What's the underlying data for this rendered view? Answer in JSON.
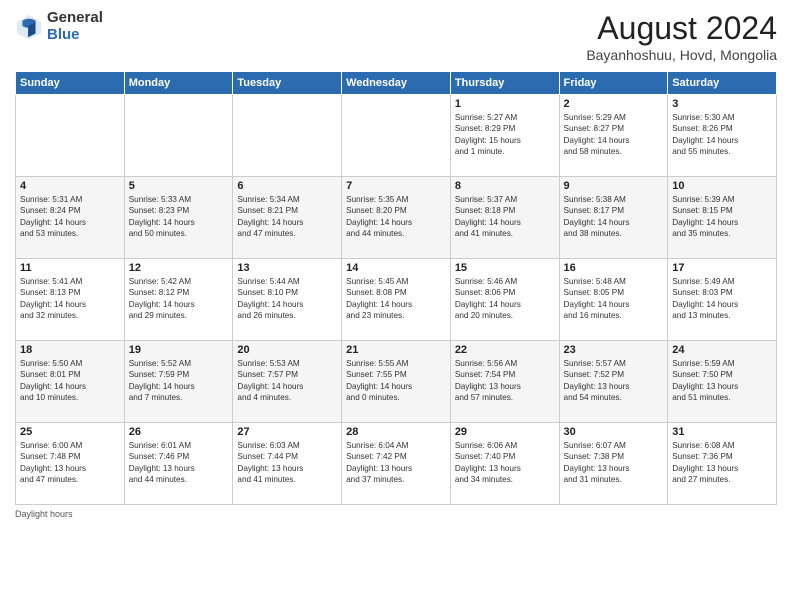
{
  "header": {
    "logo_general": "General",
    "logo_blue": "Blue",
    "month_title": "August 2024",
    "location": "Bayanhoshuu, Hovd, Mongolia"
  },
  "days_of_week": [
    "Sunday",
    "Monday",
    "Tuesday",
    "Wednesday",
    "Thursday",
    "Friday",
    "Saturday"
  ],
  "footer_text": "Daylight hours",
  "weeks": [
    [
      {
        "day": "",
        "info": ""
      },
      {
        "day": "",
        "info": ""
      },
      {
        "day": "",
        "info": ""
      },
      {
        "day": "",
        "info": ""
      },
      {
        "day": "1",
        "info": "Sunrise: 5:27 AM\nSunset: 8:29 PM\nDaylight: 15 hours\nand 1 minute."
      },
      {
        "day": "2",
        "info": "Sunrise: 5:29 AM\nSunset: 8:27 PM\nDaylight: 14 hours\nand 58 minutes."
      },
      {
        "day": "3",
        "info": "Sunrise: 5:30 AM\nSunset: 8:26 PM\nDaylight: 14 hours\nand 55 minutes."
      }
    ],
    [
      {
        "day": "4",
        "info": "Sunrise: 5:31 AM\nSunset: 8:24 PM\nDaylight: 14 hours\nand 53 minutes."
      },
      {
        "day": "5",
        "info": "Sunrise: 5:33 AM\nSunset: 8:23 PM\nDaylight: 14 hours\nand 50 minutes."
      },
      {
        "day": "6",
        "info": "Sunrise: 5:34 AM\nSunset: 8:21 PM\nDaylight: 14 hours\nand 47 minutes."
      },
      {
        "day": "7",
        "info": "Sunrise: 5:35 AM\nSunset: 8:20 PM\nDaylight: 14 hours\nand 44 minutes."
      },
      {
        "day": "8",
        "info": "Sunrise: 5:37 AM\nSunset: 8:18 PM\nDaylight: 14 hours\nand 41 minutes."
      },
      {
        "day": "9",
        "info": "Sunrise: 5:38 AM\nSunset: 8:17 PM\nDaylight: 14 hours\nand 38 minutes."
      },
      {
        "day": "10",
        "info": "Sunrise: 5:39 AM\nSunset: 8:15 PM\nDaylight: 14 hours\nand 35 minutes."
      }
    ],
    [
      {
        "day": "11",
        "info": "Sunrise: 5:41 AM\nSunset: 8:13 PM\nDaylight: 14 hours\nand 32 minutes."
      },
      {
        "day": "12",
        "info": "Sunrise: 5:42 AM\nSunset: 8:12 PM\nDaylight: 14 hours\nand 29 minutes."
      },
      {
        "day": "13",
        "info": "Sunrise: 5:44 AM\nSunset: 8:10 PM\nDaylight: 14 hours\nand 26 minutes."
      },
      {
        "day": "14",
        "info": "Sunrise: 5:45 AM\nSunset: 8:08 PM\nDaylight: 14 hours\nand 23 minutes."
      },
      {
        "day": "15",
        "info": "Sunrise: 5:46 AM\nSunset: 8:06 PM\nDaylight: 14 hours\nand 20 minutes."
      },
      {
        "day": "16",
        "info": "Sunrise: 5:48 AM\nSunset: 8:05 PM\nDaylight: 14 hours\nand 16 minutes."
      },
      {
        "day": "17",
        "info": "Sunrise: 5:49 AM\nSunset: 8:03 PM\nDaylight: 14 hours\nand 13 minutes."
      }
    ],
    [
      {
        "day": "18",
        "info": "Sunrise: 5:50 AM\nSunset: 8:01 PM\nDaylight: 14 hours\nand 10 minutes."
      },
      {
        "day": "19",
        "info": "Sunrise: 5:52 AM\nSunset: 7:59 PM\nDaylight: 14 hours\nand 7 minutes."
      },
      {
        "day": "20",
        "info": "Sunrise: 5:53 AM\nSunset: 7:57 PM\nDaylight: 14 hours\nand 4 minutes."
      },
      {
        "day": "21",
        "info": "Sunrise: 5:55 AM\nSunset: 7:55 PM\nDaylight: 14 hours\nand 0 minutes."
      },
      {
        "day": "22",
        "info": "Sunrise: 5:56 AM\nSunset: 7:54 PM\nDaylight: 13 hours\nand 57 minutes."
      },
      {
        "day": "23",
        "info": "Sunrise: 5:57 AM\nSunset: 7:52 PM\nDaylight: 13 hours\nand 54 minutes."
      },
      {
        "day": "24",
        "info": "Sunrise: 5:59 AM\nSunset: 7:50 PM\nDaylight: 13 hours\nand 51 minutes."
      }
    ],
    [
      {
        "day": "25",
        "info": "Sunrise: 6:00 AM\nSunset: 7:48 PM\nDaylight: 13 hours\nand 47 minutes."
      },
      {
        "day": "26",
        "info": "Sunrise: 6:01 AM\nSunset: 7:46 PM\nDaylight: 13 hours\nand 44 minutes."
      },
      {
        "day": "27",
        "info": "Sunrise: 6:03 AM\nSunset: 7:44 PM\nDaylight: 13 hours\nand 41 minutes."
      },
      {
        "day": "28",
        "info": "Sunrise: 6:04 AM\nSunset: 7:42 PM\nDaylight: 13 hours\nand 37 minutes."
      },
      {
        "day": "29",
        "info": "Sunrise: 6:06 AM\nSunset: 7:40 PM\nDaylight: 13 hours\nand 34 minutes."
      },
      {
        "day": "30",
        "info": "Sunrise: 6:07 AM\nSunset: 7:38 PM\nDaylight: 13 hours\nand 31 minutes."
      },
      {
        "day": "31",
        "info": "Sunrise: 6:08 AM\nSunset: 7:36 PM\nDaylight: 13 hours\nand 27 minutes."
      }
    ]
  ]
}
